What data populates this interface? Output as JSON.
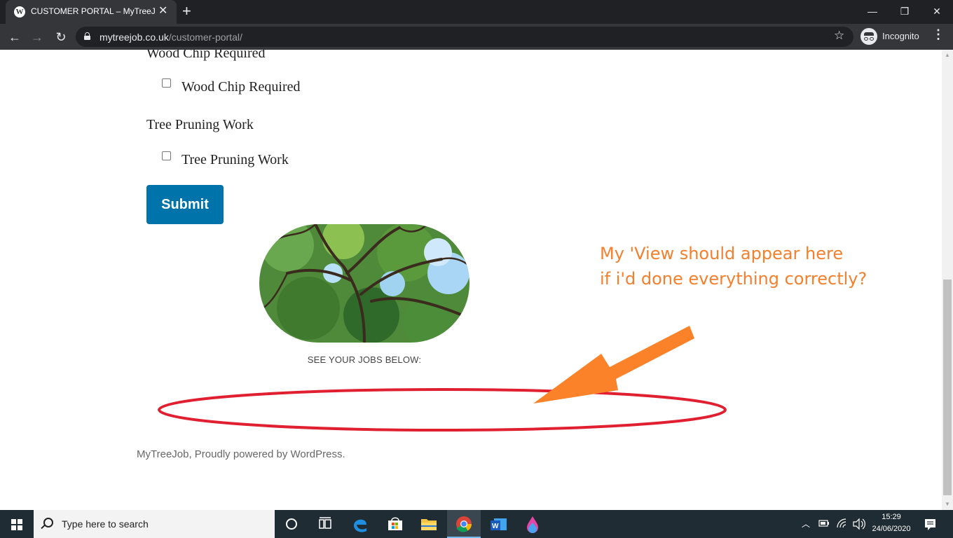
{
  "browser": {
    "tab_title": "CUSTOMER PORTAL – MyTreeJob",
    "tab_close": "✕",
    "new_tab": "+",
    "url_domain": "mytreejob.co.uk",
    "url_path": "/customer-portal/",
    "profile_label": "Incognito",
    "window_controls": {
      "minimize": "—",
      "restore": "❐",
      "close": "✕"
    },
    "nav": {
      "back": "←",
      "forward": "→",
      "reload": "↻",
      "star": "☆",
      "menu": "⋮"
    }
  },
  "form": {
    "wood_chip": {
      "heading": "Wood Chip Required",
      "option_label": "Wood Chip Required",
      "checked": false
    },
    "tree_pruning": {
      "heading": "Tree Pruning Work",
      "option_label": "Tree Pruning Work",
      "checked": false
    },
    "submit_label": "Submit"
  },
  "content": {
    "caption": "SEE YOUR JOBS BELOW:",
    "footer_site": "MyTreeJob",
    "footer_text": ", Proudly powered by WordPress."
  },
  "annotation": {
    "line1": "My 'View should appear here",
    "line2": "if i'd done everything correctly?",
    "text_color": "#f47f2c",
    "ellipse_color": "#e02030",
    "arrow_color": "#fb8228"
  },
  "taskbar": {
    "search_placeholder": "Type here to search",
    "time": "15:29",
    "date": "24/06/2020",
    "pinned_icons": [
      "cortana-icon",
      "task-view-icon",
      "edge-icon",
      "store-icon",
      "file-explorer-icon",
      "chrome-icon",
      "word-icon",
      "paint-icon"
    ]
  },
  "colors": {
    "submit_bg": "#0073aa",
    "chrome_dark": "#202124",
    "chrome_toolbar": "#35363a",
    "taskbar_bg": "#202c33"
  }
}
